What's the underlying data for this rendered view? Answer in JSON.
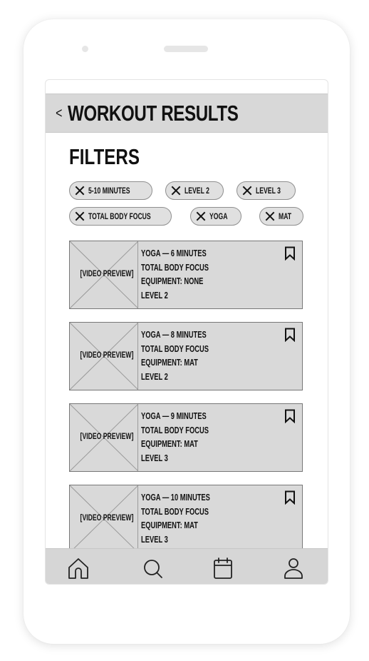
{
  "header": {
    "back_symbol": "<",
    "title": "WORKOUT RESULTS"
  },
  "filters": {
    "title": "FILTERS",
    "chips": [
      {
        "label": "5-10 MINUTES"
      },
      {
        "label": "LEVEL 2"
      },
      {
        "label": "LEVEL 3"
      },
      {
        "label": "TOTAL BODY FOCUS"
      },
      {
        "label": "YOGA"
      },
      {
        "label": "MAT"
      }
    ]
  },
  "results": [
    {
      "preview": "[VIDEO PREVIEW]",
      "line1": "YOGA  —  6 MINUTES",
      "line2": "TOTAL BODY FOCUS",
      "line3": "EQUIPMENT: NONE",
      "line4": "LEVEL 2"
    },
    {
      "preview": "[VIDEO PREVIEW]",
      "line1": "YOGA  —  8 MINUTES",
      "line2": "TOTAL BODY FOCUS",
      "line3": "EQUIPMENT: MAT",
      "line4": "LEVEL 2"
    },
    {
      "preview": "[VIDEO PREVIEW]",
      "line1": "YOGA  —  9 MINUTES",
      "line2": "TOTAL BODY FOCUS",
      "line3": "EQUIPMENT: MAT",
      "line4": "LEVEL 3"
    },
    {
      "preview": "[VIDEO PREVIEW]",
      "line1": "YOGA  —  10 MINUTES",
      "line2": "TOTAL BODY FOCUS",
      "line3": "EQUIPMENT: MAT",
      "line4": "LEVEL 3"
    }
  ],
  "nav": {
    "items": [
      {
        "icon": "home-icon"
      },
      {
        "icon": "search-icon"
      },
      {
        "icon": "calendar-icon"
      },
      {
        "icon": "profile-icon"
      }
    ]
  },
  "colors": {
    "header_bg": "#d8d8d8",
    "card_bg": "#d9d9d9",
    "chip_bg": "#e0e0e0",
    "nav_bg": "#d6d6d6"
  }
}
